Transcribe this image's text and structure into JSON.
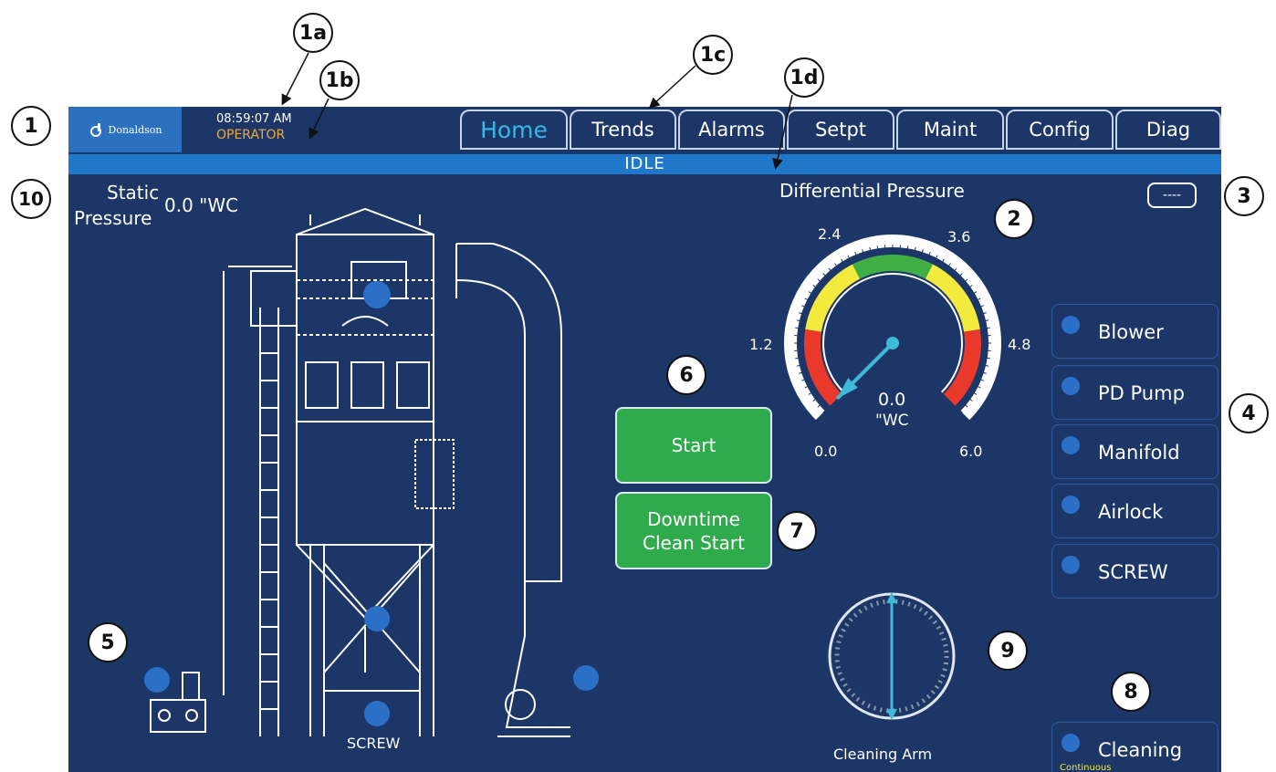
{
  "header": {
    "logo_text": "Donaldson",
    "time": "08:59:07 AM",
    "user_level": "OPERATOR",
    "tabs": [
      {
        "label": "Home",
        "active": true
      },
      {
        "label": "Trends",
        "active": false
      },
      {
        "label": "Alarms",
        "active": false
      },
      {
        "label": "Setpt",
        "active": false
      },
      {
        "label": "Maint",
        "active": false
      },
      {
        "label": "Config",
        "active": false
      },
      {
        "label": "Diag",
        "active": false
      }
    ]
  },
  "status": "IDLE",
  "static_pressure": {
    "label_line1": "Static",
    "label_line2": "Pressure",
    "value": "0.0 \"WC"
  },
  "differential_pressure": {
    "title": "Differential Pressure",
    "value": "0.0",
    "unit": "\"WC",
    "scale_labels": [
      "0.0",
      "1.2",
      "2.4",
      "3.6",
      "4.8",
      "6.0"
    ],
    "min": 0.0,
    "max": 6.0,
    "current": 0.0,
    "zones": [
      {
        "color": "#e8392b",
        "from": 0.0,
        "to": 1.2
      },
      {
        "color": "#f2ea3d",
        "from": 1.2,
        "to": 2.4
      },
      {
        "color": "#3fae45",
        "from": 2.4,
        "to": 3.6
      },
      {
        "color": "#f2ea3d",
        "from": 3.6,
        "to": 4.8
      },
      {
        "color": "#e8392b",
        "from": 4.8,
        "to": 6.0
      }
    ]
  },
  "display_mode": "----",
  "buttons": {
    "start": "Start",
    "downtime_line1": "Downtime",
    "downtime_line2": "Clean Start"
  },
  "devices": [
    {
      "label": "Blower"
    },
    {
      "label": "PD Pump"
    },
    {
      "label": "Manifold"
    },
    {
      "label": "Airlock"
    },
    {
      "label": "SCREW"
    }
  ],
  "cleaning": {
    "label": "Cleaning",
    "mode": "Continuous"
  },
  "cleaning_arm_label": "Cleaning Arm",
  "screw_label": "SCREW",
  "callouts": [
    "1",
    "1a",
    "1b",
    "1c",
    "1d",
    "2",
    "3",
    "4",
    "5",
    "6",
    "7",
    "8",
    "9",
    "10"
  ],
  "colors": {
    "background": "#1b3667",
    "status_bar": "#1f78c9",
    "button_green": "#2faa4d",
    "indicator_off": "#2c6fc7",
    "user_level": "#f0a93b",
    "active_tab": "#38b8e8",
    "needle": "#3fb9d8"
  }
}
